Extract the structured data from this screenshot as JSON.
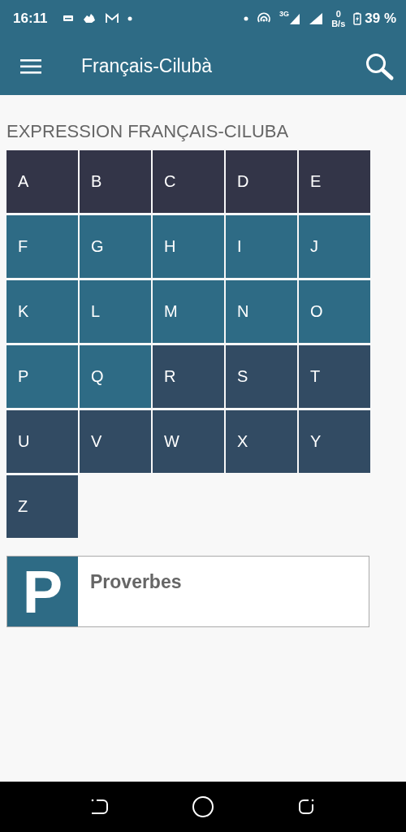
{
  "status_bar": {
    "time": "16:11",
    "network_type": "3G",
    "speed_value": "0",
    "speed_unit": "B/s",
    "battery": "39 %"
  },
  "app_bar": {
    "title": "Français-Cilubà"
  },
  "heading": "EXPRESSION FRANÇAIS-CILUBA",
  "letters": [
    {
      "label": "A",
      "color": "#333548"
    },
    {
      "label": "B",
      "color": "#333548"
    },
    {
      "label": "C",
      "color": "#333548"
    },
    {
      "label": "D",
      "color": "#333548"
    },
    {
      "label": "E",
      "color": "#333548"
    },
    {
      "label": "F",
      "color": "#2e6b85"
    },
    {
      "label": "G",
      "color": "#2e6b85"
    },
    {
      "label": "H",
      "color": "#2e6b85"
    },
    {
      "label": "I",
      "color": "#2e6b85"
    },
    {
      "label": "J",
      "color": "#2e6b85"
    },
    {
      "label": "K",
      "color": "#2e6b85"
    },
    {
      "label": "L",
      "color": "#2e6b85"
    },
    {
      "label": "M",
      "color": "#2e6b85"
    },
    {
      "label": "N",
      "color": "#2e6b85"
    },
    {
      "label": "O",
      "color": "#2e6b85"
    },
    {
      "label": "P",
      "color": "#2e6b85"
    },
    {
      "label": "Q",
      "color": "#2e6b85"
    },
    {
      "label": "R",
      "color": "#324b63"
    },
    {
      "label": "S",
      "color": "#324b63"
    },
    {
      "label": "T",
      "color": "#324b63"
    },
    {
      "label": "U",
      "color": "#324b63"
    },
    {
      "label": "V",
      "color": "#324b63"
    },
    {
      "label": "W",
      "color": "#324b63"
    },
    {
      "label": "X",
      "color": "#324b63"
    },
    {
      "label": "Y",
      "color": "#324b63"
    },
    {
      "label": "Z",
      "color": "#324b63"
    }
  ],
  "proverbs_card": {
    "letter": "P",
    "title": "Proverbes"
  }
}
